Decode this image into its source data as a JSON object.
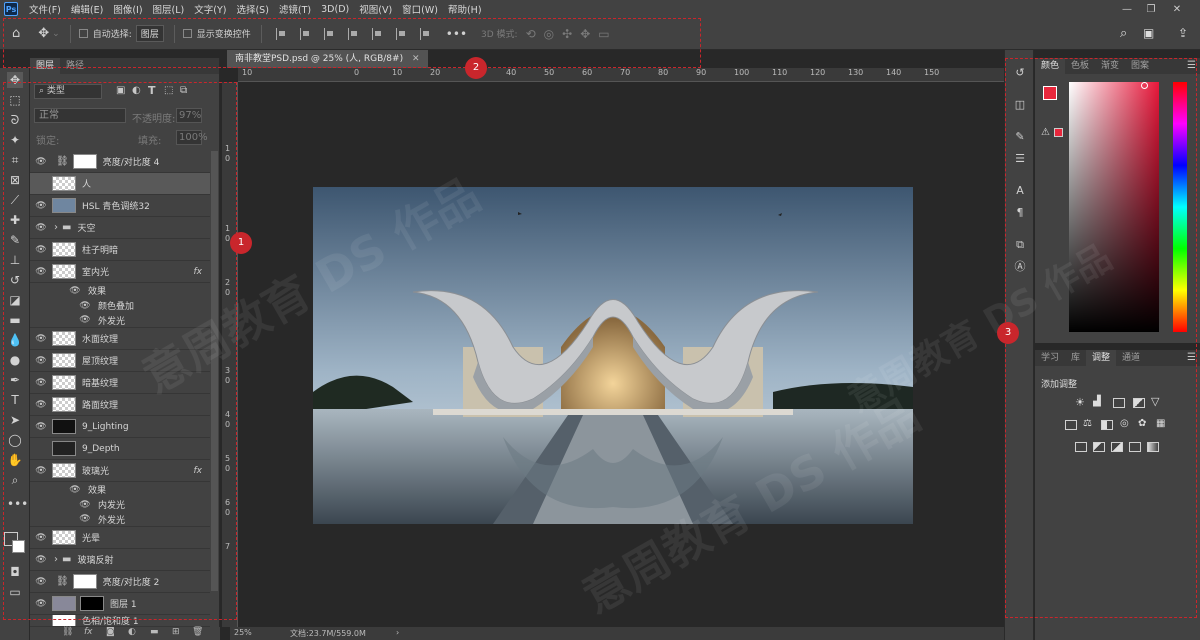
{
  "menubar": {
    "app_icon": "Ps",
    "items": [
      "文件(F)",
      "编辑(E)",
      "图像(I)",
      "图层(L)",
      "文字(Y)",
      "选择(S)",
      "滤镜(T)",
      "3D(D)",
      "视图(V)",
      "窗口(W)",
      "帮助(H)"
    ]
  },
  "options": {
    "auto_select": "自动选择:",
    "layer_select": "图层",
    "show_transform": "显示变换控件",
    "mode_3d": "3D 模式:"
  },
  "document": {
    "tab": "南非教堂PSD.psd @ 25% (人, RGB/8#)",
    "zoom": "25%",
    "doc_info": "文档:23.7M/559.0M"
  },
  "rulers": {
    "h": [
      "10",
      "0",
      "10",
      "20",
      "30",
      "40",
      "50",
      "60",
      "70",
      "80",
      "90",
      "100",
      "110",
      "120",
      "130",
      "140",
      "150"
    ],
    "v": [
      "1",
      "0",
      "1",
      "0",
      "2",
      "0",
      "3",
      "0",
      "4",
      "0",
      "5",
      "0",
      "6",
      "0",
      "7"
    ]
  },
  "layers_panel": {
    "tabs": [
      "图层",
      "路径"
    ],
    "filter_kind": "类型",
    "blend_mode": "正常",
    "opacity_label": "不透明度:",
    "opacity": "97%",
    "lock_label": "锁定:",
    "fill_label": "填充:",
    "fill": "100%",
    "layers": [
      {
        "name": "亮度/对比度 4"
      },
      {
        "name": "人"
      },
      {
        "name": "HSL 青色调统32"
      },
      {
        "name": "天空"
      },
      {
        "name": "柱子明暗"
      },
      {
        "name": "室内光"
      },
      {
        "name": "效果"
      },
      {
        "name": "颜色叠加"
      },
      {
        "name": "外发光"
      },
      {
        "name": "水面纹理"
      },
      {
        "name": "屋顶纹理"
      },
      {
        "name": "暗基纹理"
      },
      {
        "name": "路面纹理"
      },
      {
        "name": "9_Lighting"
      },
      {
        "name": "9_Depth"
      },
      {
        "name": "玻璃光"
      },
      {
        "name": "效果"
      },
      {
        "name": "内发光"
      },
      {
        "name": "外发光"
      },
      {
        "name": "光晕"
      },
      {
        "name": "玻璃反射"
      },
      {
        "name": "亮度/对比度 2"
      },
      {
        "name": "图层 1"
      },
      {
        "name": "色相/饱和度 1"
      }
    ]
  },
  "color_panel": {
    "tabs": [
      "颜色",
      "色板",
      "渐变",
      "图案"
    ],
    "fg": "#e8273c",
    "bg": "#ffffff"
  },
  "adjust_panel": {
    "tabs": [
      "学习",
      "库",
      "调整",
      "通道"
    ],
    "title": "添加调整"
  },
  "markers": [
    "1",
    "2",
    "3"
  ],
  "watermark": "意周教育 DS 作品",
  "colors": {
    "accent": "#c9262c",
    "panel": "#424242",
    "canvas": "#282828"
  }
}
